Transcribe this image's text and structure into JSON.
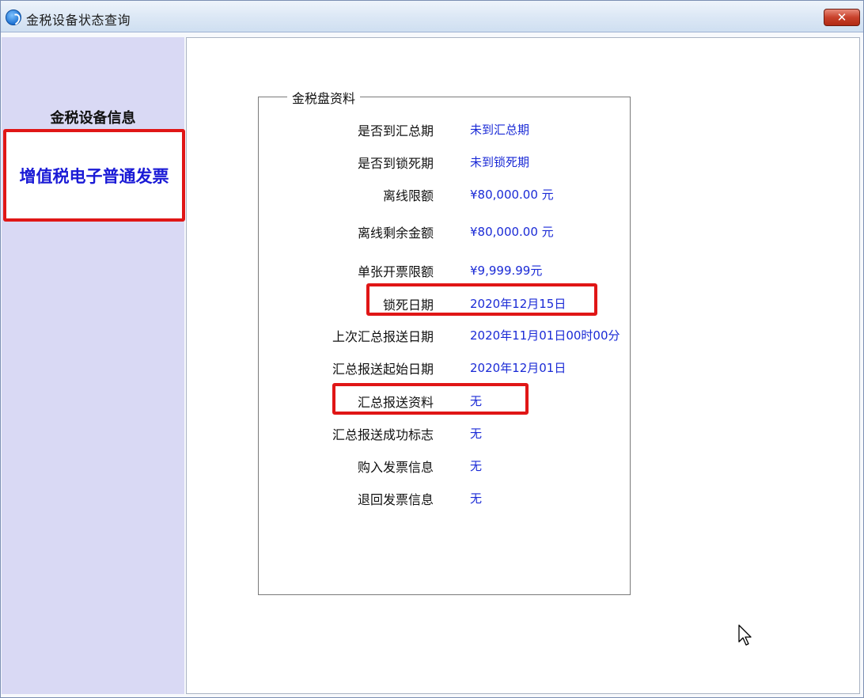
{
  "window": {
    "title": "金税设备状态查询",
    "close_label": "✕"
  },
  "sidebar": {
    "header": "金税设备信息",
    "items": [
      {
        "label": "增值税电子普通发票",
        "selected": true
      }
    ]
  },
  "group": {
    "legend": "金税盘资料",
    "rows": [
      {
        "label": "是否到汇总期",
        "value": "未到汇总期"
      },
      {
        "label": "是否到锁死期",
        "value": "未到锁死期"
      },
      {
        "label": "离线限额",
        "value": "¥80,000.00 元"
      },
      {
        "label": "离线剩余金额",
        "value": "¥80,000.00 元"
      },
      {
        "label": "单张开票限额",
        "value": "¥9,999.99元"
      },
      {
        "label": "锁死日期",
        "value": "2020年12月15日"
      },
      {
        "label": "上次汇总报送日期",
        "value": "2020年11月01日00时00分"
      },
      {
        "label": "汇总报送起始日期",
        "value": "2020年12月01日"
      },
      {
        "label": "汇总报送资料",
        "value": "无"
      },
      {
        "label": "汇总报送成功标志",
        "value": "无"
      },
      {
        "label": "购入发票信息",
        "value": "无"
      },
      {
        "label": "退回发票信息",
        "value": "无"
      }
    ]
  },
  "colors": {
    "sidebar_bg": "#d9d9f4",
    "highlight_border": "#e01616",
    "value_text": "#1a2ad6",
    "selected_item_text": "#1a1ad6"
  },
  "icons": {
    "app": "app-logo-icon",
    "close": "close-icon",
    "cursor": "mouse-pointer-icon"
  }
}
